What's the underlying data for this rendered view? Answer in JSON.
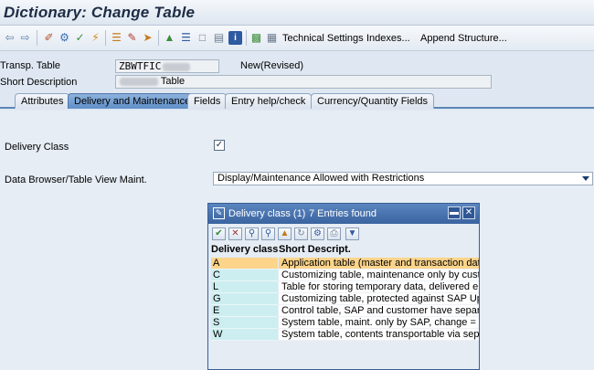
{
  "window": {
    "title": "Dictionary: Change Table"
  },
  "toolbar": {
    "technical_settings": "Technical Settings",
    "indexes": "Indexes...",
    "append_structure": "Append Structure..."
  },
  "header": {
    "transp_table_label": "Transp. Table",
    "transp_table_value": "ZBWTFIC",
    "status": "New(Revised)",
    "short_desc_label": "Short Description",
    "short_desc_value": "Table"
  },
  "tabs": [
    {
      "label": "Attributes",
      "active": false
    },
    {
      "label": "Delivery and Maintenance",
      "active": true
    },
    {
      "label": "Fields",
      "active": false
    },
    {
      "label": "Entry help/check",
      "active": false
    },
    {
      "label": "Currency/Quantity Fields",
      "active": false
    }
  ],
  "content": {
    "delivery_class_label": "Delivery Class",
    "data_browser_label": "Data Browser/Table View Maint.",
    "data_browser_value": "Display/Maintenance Allowed with Restrictions"
  },
  "popup": {
    "title": "Delivery class (1)",
    "entries_found": "7 Entries found",
    "col_code": "Delivery class",
    "col_desc": "Short Descript.",
    "rows": [
      {
        "code": "A",
        "desc": "Application table (master and transaction data)",
        "selected": true
      },
      {
        "code": "C",
        "desc": "Customizing table, maintenance only by cust., no",
        "selected": false
      },
      {
        "code": "L",
        "desc": "Table for storing temporary data, delivered empt",
        "selected": false
      },
      {
        "code": "G",
        "desc": "Customizing table, protected against SAP Upd., o",
        "selected": false
      },
      {
        "code": "E",
        "desc": "Control table, SAP and customer have separate k",
        "selected": false
      },
      {
        "code": "S",
        "desc": "System table, maint. only by SAP, change = moo",
        "selected": false
      },
      {
        "code": "W",
        "desc": "System table, contents transportable via separat",
        "selected": false
      }
    ]
  },
  "colors": {
    "selected_row": "#fcd48a",
    "code_column": "#cdeef0",
    "popup_title": "#3a64a0"
  }
}
